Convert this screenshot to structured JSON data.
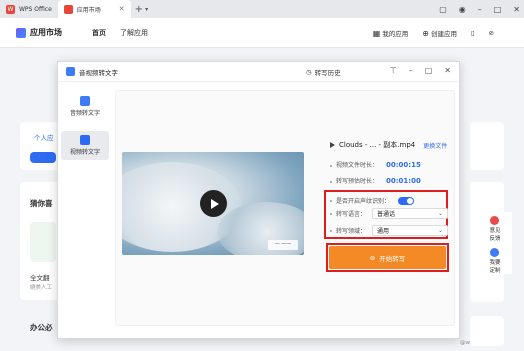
{
  "tabs": [
    {
      "label": "WPS Office"
    },
    {
      "label": "应用市场"
    }
  ],
  "app": {
    "title": "应用市场",
    "nav": [
      "首页",
      "了解应用"
    ],
    "my_apps": "我的应用",
    "create_app": "创建应用"
  },
  "background": {
    "personal": "个人应",
    "section_title": "猜你喜",
    "fulltext": "全文翻",
    "human_translate": "媲美人工",
    "office_title": "办公必",
    "side_actions": [
      {
        "label": "意见\n反馈"
      },
      {
        "label": "我要\n定制"
      }
    ],
    "bottom_brand": "@w"
  },
  "dialog": {
    "title": "音视频转文字",
    "history": "转写历史",
    "sidebar": [
      {
        "label": "音频转文字"
      },
      {
        "label": "视频转文字"
      }
    ],
    "file_name": "Clouds - ... - 副本.mp4",
    "change_file": "更换文件",
    "duration_label": "视频文件时长：",
    "duration_value": "00:00:15",
    "estimate_label": "转写预估时长：",
    "estimate_value": "00:01:00",
    "speaker_label": "是否开启声纹识别：",
    "speaker_on": true,
    "language_label": "转写语言：",
    "language_value": "普通话",
    "domain_label": "转写领域：",
    "domain_value": "通用",
    "start_label": "开始转写",
    "video_overlay": "一 一一"
  },
  "colors": {
    "accent": "#2d6bf0",
    "start_button": "#f48a26",
    "highlight": "#e11c1c"
  }
}
